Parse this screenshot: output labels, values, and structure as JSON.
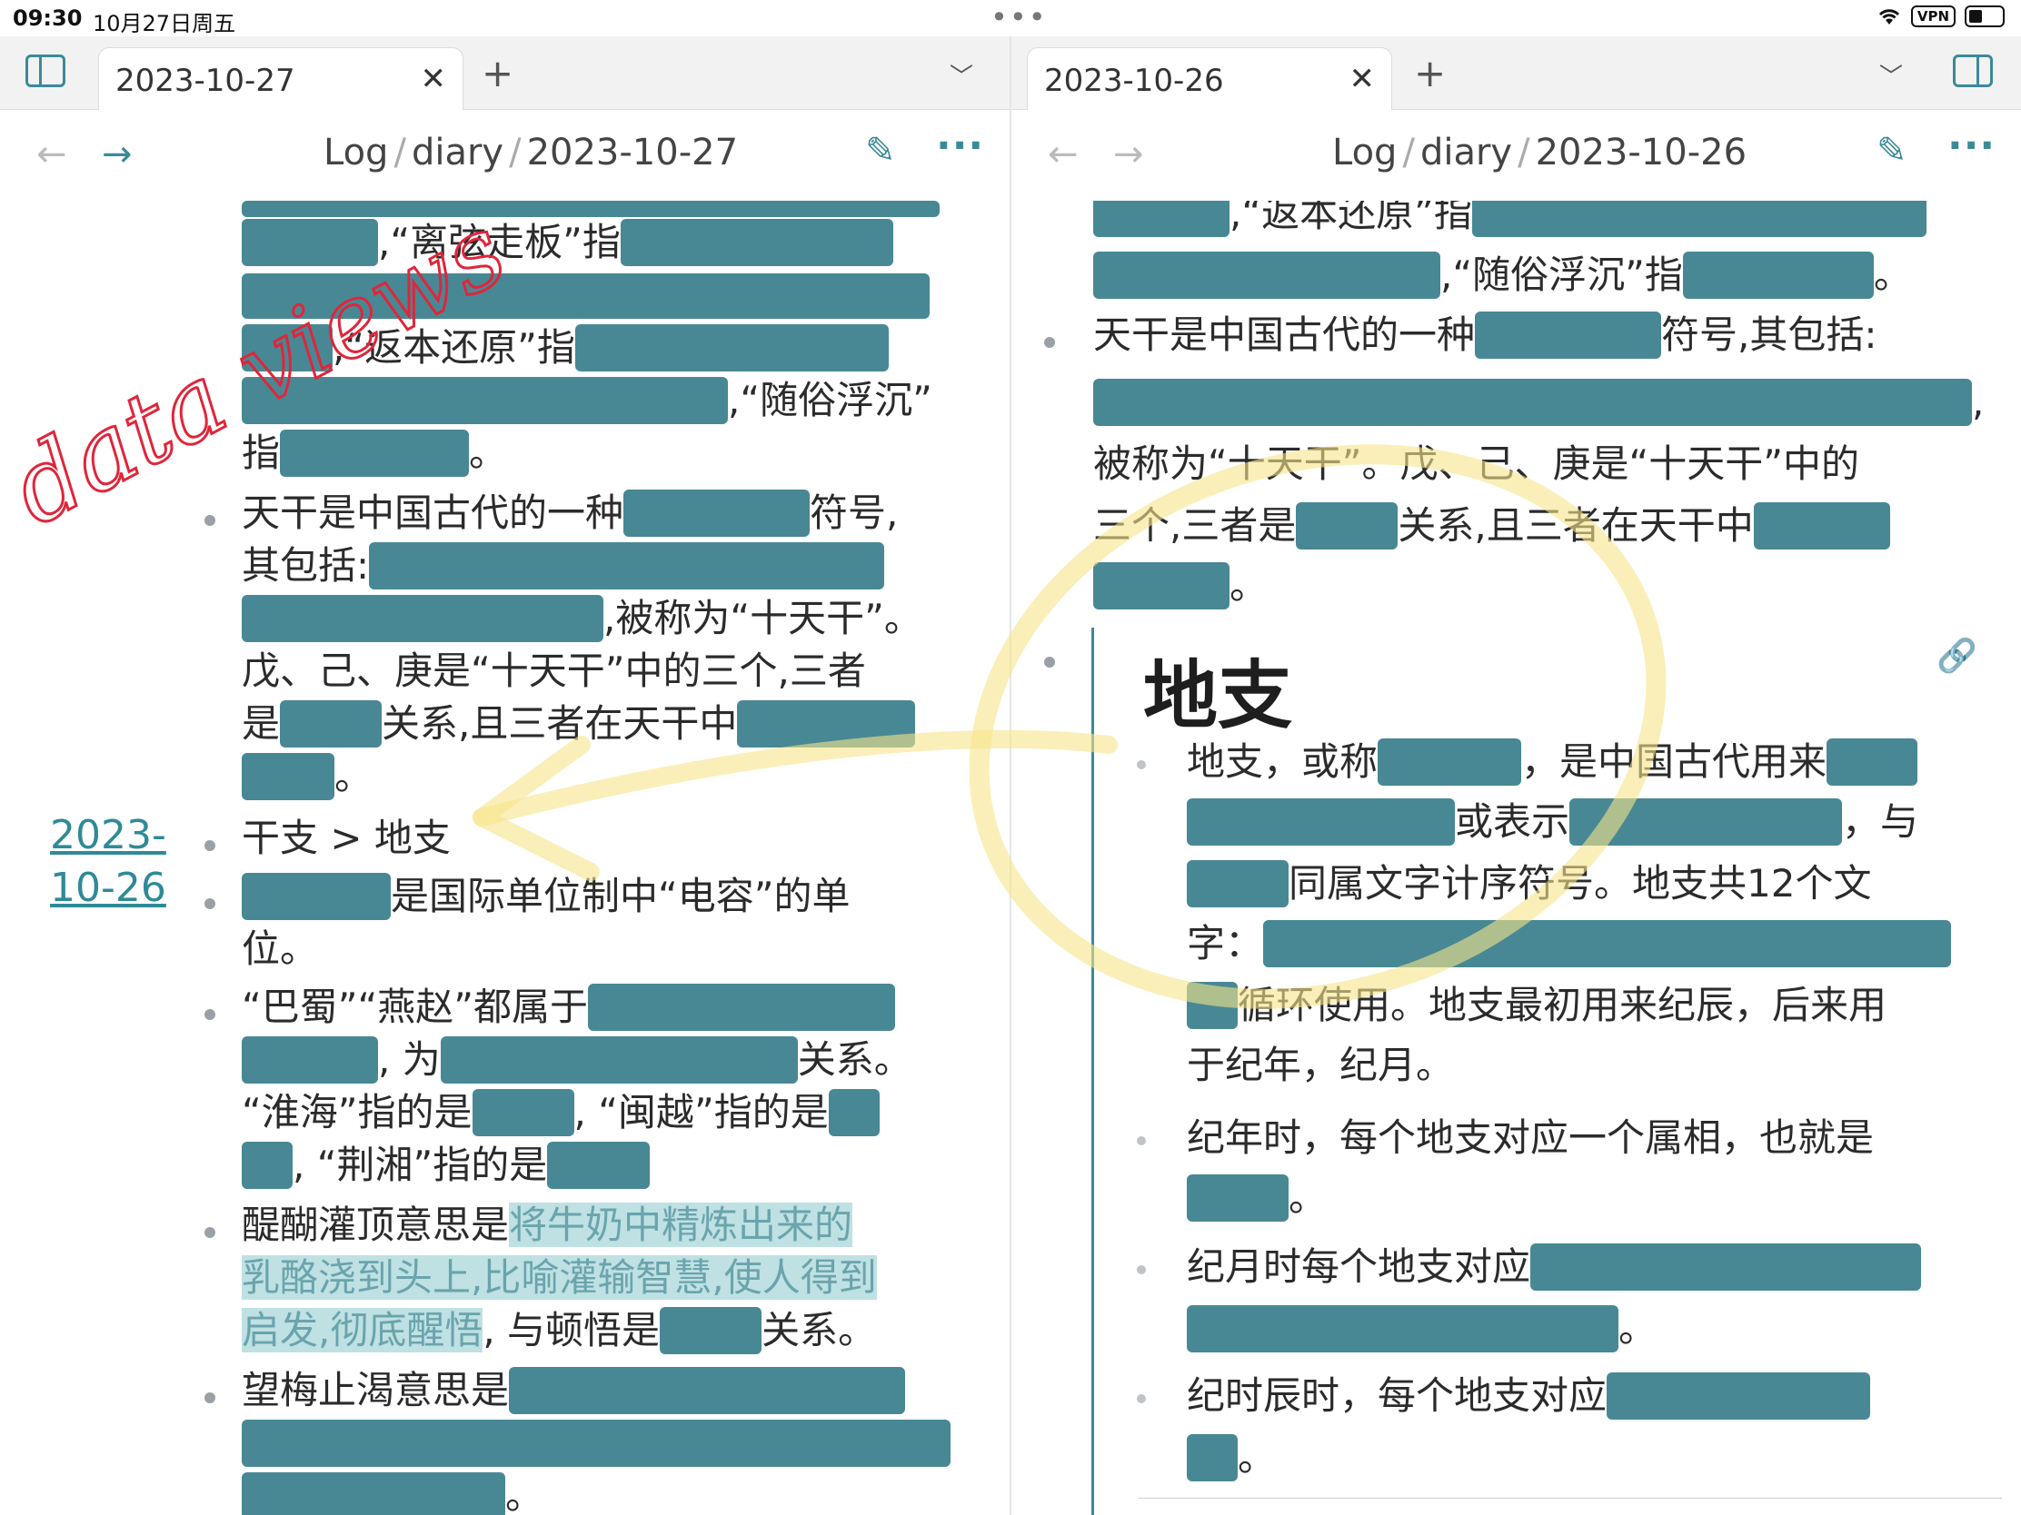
{
  "status": {
    "time": "09:30",
    "date": "10月27日周五",
    "vpn": "VPN"
  },
  "left": {
    "tab_title": "2023-10-27",
    "crumbs": [
      "Log",
      "diary",
      "2023-10-27"
    ],
    "side_link": [
      "2023-",
      "10-26"
    ],
    "lines": {
      "l1": ",“离弦走板”指",
      "l3": ",“返本还原”指",
      "l4": ",“随俗浮沉”",
      "l5a": "指",
      "l5b": "。",
      "l6a": "天干是中国古代的一种",
      "l6b": "符号,",
      "l7": "其包括:",
      "l8": ",被称为“十天干”。",
      "l9": "戊、己、庚是“十天干”中的三个,三者",
      "l10a": "是",
      "l10b": "关系,且三者在天干中",
      "l11": "。",
      "l12": "干支 > 地支",
      "l13": "是国际单位制中“电容”的单",
      "l14": "位。",
      "l15": "“巴蜀”“燕赵”都属于",
      "l16a": ", 为",
      "l16b": "关系。",
      "l17a": "“淮海”指的是",
      "l17b": ", “闽越”指的是",
      "l18a": ", “荆湘”指的是",
      "l19a": "醍醐灌顶意思是",
      "l19b": "将牛奶中精炼出来的",
      "l20": "乳酪浇到头上,比喻灌输智慧,使人得到",
      "l21a": "启发,彻底醒悟",
      "l21b": ", 与顿悟是",
      "l21c": "关系。",
      "l22": "望梅止渴意思是",
      "l24": "。"
    },
    "annotation": "data views"
  },
  "right": {
    "tab_title": "2023-10-26",
    "crumbs": [
      "Log",
      "diary",
      "2023-10-26"
    ],
    "lines": {
      "r1": ",“返本还原”指",
      "r2a": ",“随俗浮沉”指",
      "r2b": "。",
      "r3a": "天干是中国古代的一种",
      "r3b": "符号,其包括:",
      "r4": ",",
      "r5": "被称为“十天干”。戊、己、庚是“十天干”中的",
      "r6a": "三个,三者是",
      "r6b": "关系,且三者在天干中",
      "r7": "。",
      "heading": "地支",
      "r8a": "地支，或称",
      "r8b": "，是中国古代用来",
      "r9a": "或表示",
      "r9b": "，与",
      "r10": "同属文字计序符号。地支共12个文",
      "r11": "字：",
      "r12": "循环使用。地支最初用来纪辰，后来用",
      "r13": "于纪年，纪月。",
      "r14": "纪年时，每个地支对应一个属相，也就是",
      "r15": "。",
      "r16": "纪月时每个地支对应",
      "r17": "。",
      "r18": "纪时辰时，每个地支对应",
      "r19": "。"
    }
  },
  "colors": {
    "accent": "#3b8a98",
    "cloze": "#488894",
    "highlight": "#bfe1e3"
  }
}
